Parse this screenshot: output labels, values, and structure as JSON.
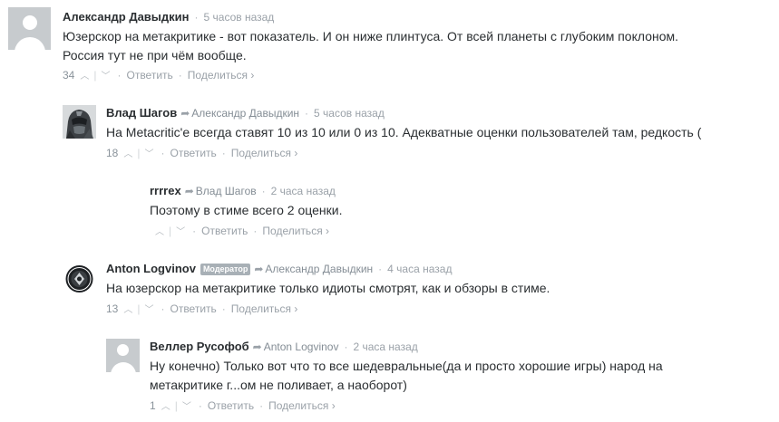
{
  "comments": [
    {
      "author": "Александр Давыдкин",
      "time": "5 часов назад",
      "lines": [
        "Юзерскор на метакритике - вот показатель. И он ниже плинтуса. От всей планеты с глубоким поклоном.",
        "Россия тут не при чём вообще."
      ],
      "score": "34",
      "reply_label": "Ответить",
      "share_label": "Поделиться ›"
    },
    {
      "author": "Влад Шагов",
      "reply_to": "Александр Давыдкин",
      "time": "5 часов назад",
      "lines": [
        "На Metacritic'е всегда ставят 10 из 10 или 0 из 10. Адекватные оценки пользователей там, редкость ("
      ],
      "score": "18",
      "reply_label": "Ответить",
      "share_label": "Поделиться ›"
    },
    {
      "author": "rrrrex",
      "reply_to": "Влад Шагов",
      "time": "2 часа назад",
      "lines": [
        "Поэтому в стиме всего 2 оценки."
      ],
      "score": "",
      "reply_label": "Ответить",
      "share_label": "Поделиться ›"
    },
    {
      "author": "Anton Logvinov",
      "badge": "Модератор",
      "reply_to": "Александр Давыдкин",
      "time": "4 часа назад",
      "lines": [
        "На юзерскор на метакритике только идиоты смотрят, как и обзоры в стиме."
      ],
      "score": "13",
      "reply_label": "Ответить",
      "share_label": "Поделиться ›"
    },
    {
      "author": "Веллер Русофоб",
      "reply_to": "Anton Logvinov",
      "time": "2 часа назад",
      "lines": [
        "Ну конечно) Только вот что то все шедевральные(да и просто хорошие игры) народ на",
        "метакритике г...ом не поливает, а наоборот)"
      ],
      "score": "1",
      "reply_label": "Ответить",
      "share_label": "Поделиться ›"
    }
  ],
  "icons": {
    "upvote": "chevron-up-icon",
    "downvote": "chevron-down-icon",
    "reply_arrow": "reply-arrow-icon",
    "default_avatar": "user-silhouette-icon"
  },
  "colors": {
    "author": "#2a2e31",
    "meta": "#9aa1a8",
    "badge": "#a8b0b6"
  }
}
